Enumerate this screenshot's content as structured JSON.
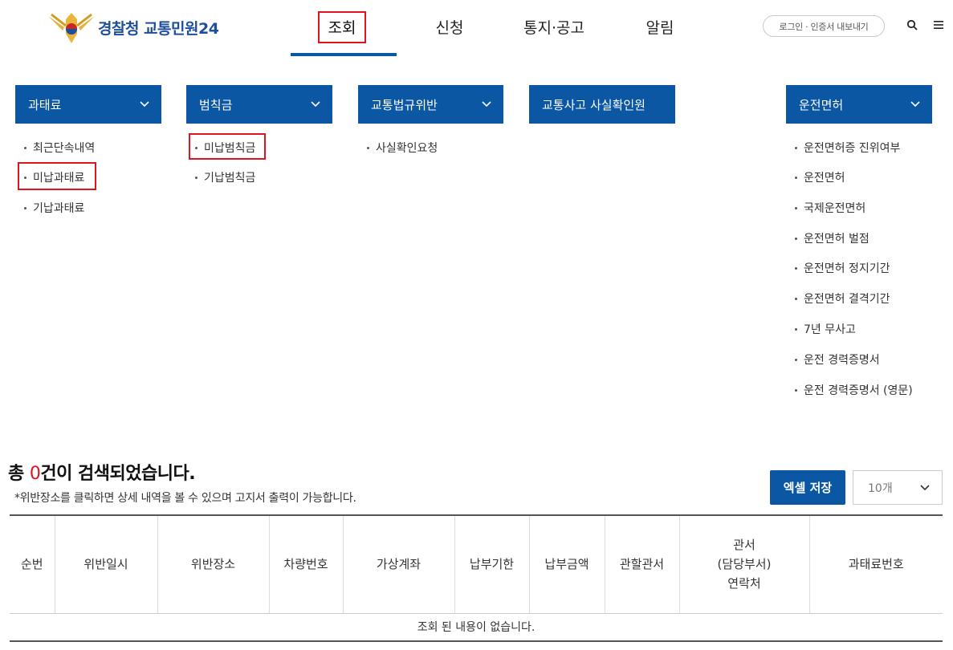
{
  "header": {
    "logo_text": "경찰청 교통민원24",
    "nav": [
      "조회",
      "신청",
      "통지·공고",
      "알림"
    ],
    "login_label": "로그인 · 인증서 내보내기"
  },
  "menus": {
    "fine": {
      "title": "과태료",
      "items": [
        "최근단속내역",
        "미납과태료",
        "기납과태료"
      ]
    },
    "penalty": {
      "title": "범칙금",
      "items": [
        "미납범칙금",
        "기납범칙금"
      ]
    },
    "violation": {
      "title": "교통법규위반",
      "items": [
        "사실확인요청"
      ]
    },
    "accident": {
      "title": "교통사고 사실확인원"
    },
    "license": {
      "title": "운전면허",
      "items": [
        "운전면허증 진위여부",
        "운전면허",
        "국제운전면허",
        "운전면허 벌점",
        "운전면허 정지기간",
        "운전면허 결격기간",
        "7년 무사고",
        "운전 경력증명서",
        "운전 경력증명서 (영문)"
      ]
    }
  },
  "result": {
    "title_prefix": "총 ",
    "count": "0",
    "title_suffix": "건이 검색되었습니다.",
    "note": "*위반장소를 클릭하면 상세 내역을 볼 수 있으며 고지서 출력이 가능합니다.",
    "excel_label": "엑셀 저장",
    "page_size": "10개",
    "columns": [
      "순번",
      "위반일시",
      "위반장소",
      "차량번호",
      "가상계좌",
      "납부기한",
      "납부금액",
      "관할관서"
    ],
    "office_col": [
      "관서",
      "(담당부서)",
      "연락처"
    ],
    "last_col": "과태료번호",
    "empty_message": "조회 된 내용이 없습니다."
  },
  "colors": {
    "primary": "#0b57a4",
    "highlight": "#e0141e"
  }
}
